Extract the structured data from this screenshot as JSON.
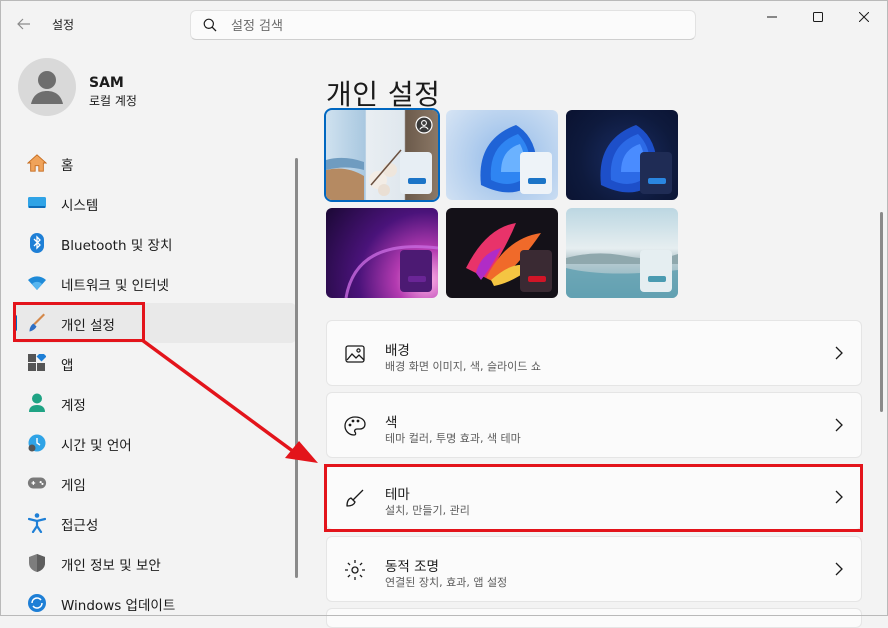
{
  "window": {
    "title": "설정"
  },
  "search": {
    "placeholder": "설정 검색"
  },
  "user": {
    "name": "SAM",
    "account_type": "로컬 계정"
  },
  "sidebar": {
    "items": [
      {
        "label": "홈",
        "icon": "home-icon"
      },
      {
        "label": "시스템",
        "icon": "system-icon"
      },
      {
        "label": "Bluetooth 및 장치",
        "icon": "bluetooth-icon"
      },
      {
        "label": "네트워크 및 인터넷",
        "icon": "network-icon"
      },
      {
        "label": "개인 설정",
        "icon": "personalization-brush-icon",
        "selected": true
      },
      {
        "label": "앱",
        "icon": "apps-icon"
      },
      {
        "label": "계정",
        "icon": "accounts-icon"
      },
      {
        "label": "시간 및 언어",
        "icon": "time-language-icon"
      },
      {
        "label": "게임",
        "icon": "gaming-icon"
      },
      {
        "label": "접근성",
        "icon": "accessibility-icon"
      },
      {
        "label": "개인 정보 및 보안",
        "icon": "privacy-shield-icon"
      },
      {
        "label": "Windows 업데이트",
        "icon": "update-icon"
      }
    ]
  },
  "main": {
    "title": "개인 설정",
    "themes": [
      {
        "name": "theme-spotlight",
        "selected": true
      },
      {
        "name": "theme-windows-light"
      },
      {
        "name": "theme-windows-dark"
      },
      {
        "name": "theme-glow"
      },
      {
        "name": "theme-captured-motion"
      },
      {
        "name": "theme-flow"
      }
    ],
    "cards": [
      {
        "title": "배경",
        "subtitle": "배경 화면 이미지, 색, 슬라이드 쇼",
        "icon": "picture-icon"
      },
      {
        "title": "색",
        "subtitle": "테마 컬러, 투명 효과, 색 테마",
        "icon": "palette-icon"
      },
      {
        "title": "테마",
        "subtitle": "설치, 만들기, 관리",
        "icon": "brush-icon"
      },
      {
        "title": "동적 조명",
        "subtitle": "연결된 장치, 효과, 앱 설정",
        "icon": "dynamic-lighting-icon"
      }
    ]
  },
  "colors": {
    "accent": "#0067c0",
    "annotation": "#e3141b"
  }
}
